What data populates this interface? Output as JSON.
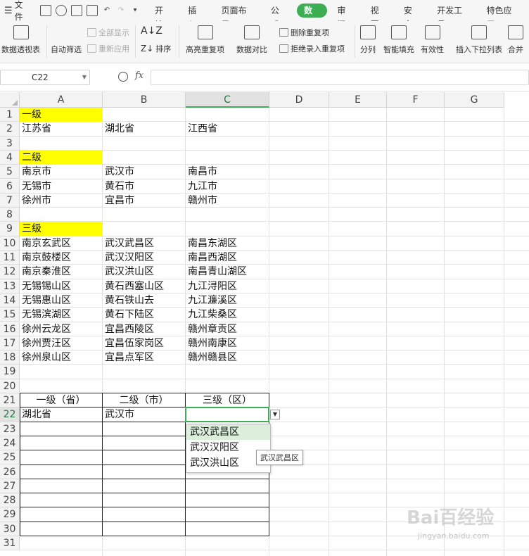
{
  "menubar": {
    "file_label": "文件",
    "tabs": [
      "开始",
      "插入",
      "页面布局",
      "公式",
      "数据",
      "审阅",
      "视图",
      "安全",
      "开发工具",
      "特色应用"
    ],
    "active_tab": "数据"
  },
  "ribbon": {
    "pivot": "数据透视表",
    "autofilter": "自动筛选",
    "show_all": "全部显示",
    "reapply": "重新应用",
    "sort": "排序",
    "highlight_dup": "高亮重复项",
    "compare": "数据对比",
    "delete_dup": "删除重复项",
    "reject_dup": "拒绝录入重复项",
    "split": "分列",
    "smart_fill": "智能填充",
    "validity": "有效性",
    "insert_dropdown": "插入下拉列表",
    "merge": "合并"
  },
  "formula_bar": {
    "name_box": "C22",
    "fx": "fx",
    "formula": ""
  },
  "columns": [
    "A",
    "B",
    "C",
    "D",
    "E",
    "F",
    "G"
  ],
  "rows": [
    "1",
    "2",
    "3",
    "4",
    "5",
    "6",
    "7",
    "8",
    "9",
    "10",
    "11",
    "12",
    "13",
    "14",
    "15",
    "16",
    "17",
    "18",
    "19",
    "20",
    "21",
    "22",
    "23",
    "24",
    "25",
    "26",
    "27",
    "28",
    "29",
    "30",
    "31"
  ],
  "cells": {
    "r1": {
      "a": "一级"
    },
    "r2": {
      "a": "江苏省",
      "b": "湖北省",
      "c": "江西省"
    },
    "r4": {
      "a": "二级"
    },
    "r5": {
      "a": "南京市",
      "b": "武汉市",
      "c": "南昌市"
    },
    "r6": {
      "a": "无锡市",
      "b": "黄石市",
      "c": "九江市"
    },
    "r7": {
      "a": "徐州市",
      "b": "宜昌市",
      "c": "赣州市"
    },
    "r9": {
      "a": "三级"
    },
    "r10": {
      "a": "南京玄武区",
      "b": "武汉武昌区",
      "c": "南昌东湖区"
    },
    "r11": {
      "a": "南京鼓楼区",
      "b": "武汉汉阳区",
      "c": "南昌西湖区"
    },
    "r12": {
      "a": "南京秦淮区",
      "b": "武汉洪山区",
      "c": "南昌青山湖区"
    },
    "r13": {
      "a": "无锡锡山区",
      "b": "黄石西塞山区",
      "c": "九江浔阳区"
    },
    "r14": {
      "a": "无锡惠山区",
      "b": "黄石铁山去",
      "c": "九江濂溪区"
    },
    "r15": {
      "a": "无锡滨湖区",
      "b": "黄石下陆区",
      "c": "九江柴桑区"
    },
    "r16": {
      "a": "徐州云龙区",
      "b": "宜昌西陵区",
      "c": "赣州章贡区"
    },
    "r17": {
      "a": "徐州贾汪区",
      "b": "宜昌伍家岗区",
      "c": "赣州南康区"
    },
    "r18": {
      "a": "徐州泉山区",
      "b": "宜昌点军区",
      "c": "赣州赣县区"
    },
    "r21": {
      "a": "一级（省）",
      "b": "二级（市）",
      "c": "三级（区）"
    },
    "r22": {
      "a": "湖北省",
      "b": "武汉市",
      "c": ""
    }
  },
  "dropdown": {
    "options": [
      "武汉武昌区",
      "武汉汉阳区",
      "武汉洪山区"
    ],
    "hovered": "武汉武昌区",
    "tooltip": "武汉武昌区"
  },
  "colors": {
    "accent": "#3dae54",
    "highlight": "#ffff00",
    "hover": "#dcefdc"
  },
  "watermark": {
    "logo": "Bai百经验",
    "url": "jingyan.baidu.com"
  }
}
